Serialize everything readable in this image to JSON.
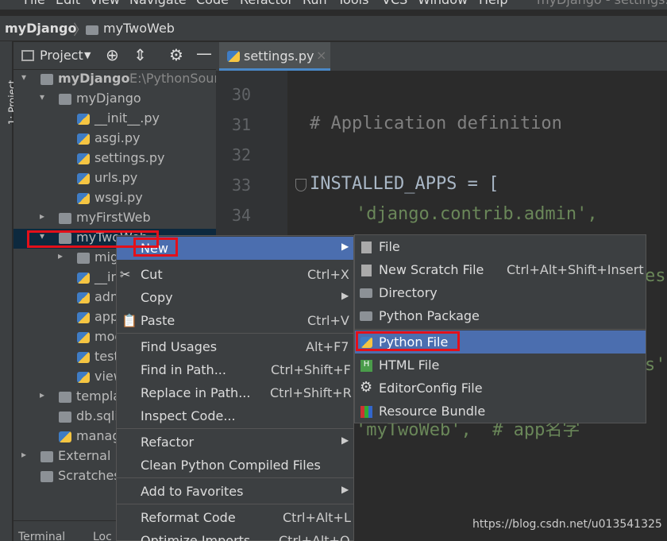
{
  "menubar": {
    "items": [
      "File",
      "Edit",
      "View",
      "Navigate",
      "Code",
      "Refactor",
      "Run",
      "Tools",
      "VCS",
      "Window",
      "Help"
    ],
    "title": "myDjango - settings.py"
  },
  "breadcrumb": {
    "root": "myDjango",
    "child": "myTwoWeb"
  },
  "left_strip": {
    "label": "1: Project"
  },
  "project_panel": {
    "title": "Project"
  },
  "tree": [
    {
      "label": "myDjango",
      "suffix": "E:\\PythonSour",
      "depth": 0,
      "arrow": "▾",
      "icon": "folder-icon"
    },
    {
      "label": "myDjango",
      "depth": 1,
      "arrow": "▾",
      "icon": "folder-icon"
    },
    {
      "label": "__init__.py",
      "depth": 2,
      "arrow": "",
      "icon": "python-file-icon"
    },
    {
      "label": "asgi.py",
      "depth": 2,
      "arrow": "",
      "icon": "python-file-icon"
    },
    {
      "label": "settings.py",
      "depth": 2,
      "arrow": "",
      "icon": "python-file-icon"
    },
    {
      "label": "urls.py",
      "depth": 2,
      "arrow": "",
      "icon": "python-file-icon"
    },
    {
      "label": "wsgi.py",
      "depth": 2,
      "arrow": "",
      "icon": "python-file-icon"
    },
    {
      "label": "myFirstWeb",
      "depth": 1,
      "arrow": "▸",
      "icon": "folder-icon"
    },
    {
      "label": "myTwoWeb",
      "depth": 1,
      "arrow": "▾",
      "icon": "folder-icon"
    },
    {
      "label": "mig",
      "depth": 2,
      "arrow": "▸",
      "icon": "folder-icon"
    },
    {
      "label": "__in",
      "depth": 2,
      "arrow": "",
      "icon": "python-file-icon"
    },
    {
      "label": "adm",
      "depth": 2,
      "arrow": "",
      "icon": "python-file-icon"
    },
    {
      "label": "app",
      "depth": 2,
      "arrow": "",
      "icon": "python-file-icon"
    },
    {
      "label": "mod",
      "depth": 2,
      "arrow": "",
      "icon": "python-file-icon"
    },
    {
      "label": "test",
      "depth": 2,
      "arrow": "",
      "icon": "python-file-icon"
    },
    {
      "label": "view",
      "depth": 2,
      "arrow": "",
      "icon": "python-file-icon"
    },
    {
      "label": "templa",
      "depth": 1,
      "arrow": "▸",
      "icon": "folder-icon"
    },
    {
      "label": "db.sqlit",
      "depth": 1,
      "arrow": "",
      "icon": "database-icon"
    },
    {
      "label": "manag",
      "depth": 1,
      "arrow": "",
      "icon": "python-file-icon"
    },
    {
      "label": "External L",
      "depth": 0,
      "arrow": "▸",
      "icon": "library-icon"
    },
    {
      "label": "Scratches",
      "depth": 0,
      "arrow": "",
      "icon": "scratches-icon"
    }
  ],
  "editor": {
    "tab_label": "settings.py",
    "line_numbers": [
      "30",
      "31",
      "32",
      "33",
      "34"
    ],
    "code_comment": "# Application definition",
    "code_installed": "INSTALLED_APPS = [",
    "code_admin": "'django.contrib.admin',",
    "code_frag_es": "es",
    "code_frag_s": "s'",
    "code_app": "'myTwoWeb',  # app名字"
  },
  "context_menu": {
    "new": "New",
    "cut": "Cut",
    "cut_key": "Ctrl+X",
    "copy": "Copy",
    "paste": "Paste",
    "paste_key": "Ctrl+V",
    "find_usages": "Find Usages",
    "find_usages_key": "Alt+F7",
    "find_in_path": "Find in Path...",
    "find_in_path_key": "Ctrl+Shift+F",
    "replace_in_path": "Replace in Path...",
    "replace_in_path_key": "Ctrl+Shift+R",
    "inspect_code": "Inspect Code...",
    "refactor": "Refactor",
    "clean_pyc": "Clean Python Compiled Files",
    "add_favorites": "Add to Favorites",
    "reformat": "Reformat Code",
    "reformat_key": "Ctrl+Alt+L",
    "optimize": "Optimize Imports",
    "optimize_key": "Ctrl+Alt+O"
  },
  "submenu": {
    "file": "File",
    "scratch": "New Scratch File",
    "scratch_key": "Ctrl+Alt+Shift+Insert",
    "directory": "Directory",
    "package": "Python Package",
    "python_file": "Python File",
    "html_file": "HTML File",
    "editorconfig": "EditorConfig File",
    "resource_bundle": "Resource Bundle"
  },
  "bottom": {
    "terminal": "Terminal",
    "local": "Loc"
  },
  "watermark": "https://blog.csdn.net/u013541325",
  "colors": {
    "highlight": "#4b6eaf",
    "annotation_red": "#e3101a",
    "keyword": "#a9b7c6",
    "string": "#6a8759",
    "comment": "#808080"
  }
}
